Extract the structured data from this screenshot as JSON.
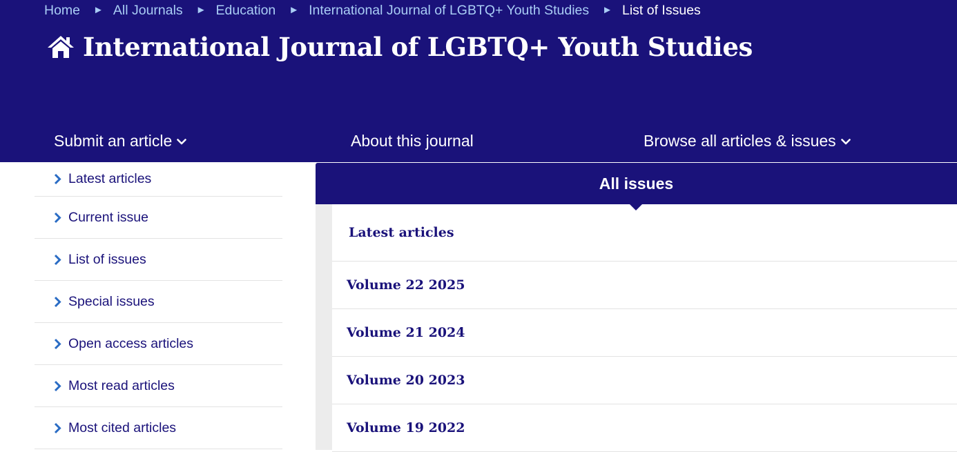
{
  "breadcrumb": {
    "items": [
      "Home",
      "All Journals",
      "Education",
      "International Journal of LGBTQ+ Youth Studies"
    ],
    "current": "List of Issues",
    "separator": "►"
  },
  "journal": {
    "title": "International Journal of LGBTQ+ Youth Studies",
    "icon": "home-icon"
  },
  "nav": {
    "submit": "Submit an article",
    "about": "About this journal",
    "browse": "Browse all articles & issues"
  },
  "sidebar": {
    "items": [
      {
        "label": "Latest articles"
      },
      {
        "label": "Current issue"
      },
      {
        "label": "List of issues"
      },
      {
        "label": "Special issues"
      },
      {
        "label": "Open access articles"
      },
      {
        "label": "Most read articles"
      },
      {
        "label": "Most cited articles"
      }
    ]
  },
  "issues": {
    "header": "All issues",
    "latest": "Latest articles",
    "volumes": [
      {
        "label": "Volume 22 2025"
      },
      {
        "label": "Volume 21 2024"
      },
      {
        "label": "Volume 20 2023"
      },
      {
        "label": "Volume 19 2022"
      }
    ]
  },
  "colors": {
    "brand_navy": "#1a127a",
    "breadcrumb_link": "#a9cdf5",
    "chevron_blue": "#2a6cc4",
    "divider": "#e3e3e3",
    "strip_gray": "#ececec"
  }
}
